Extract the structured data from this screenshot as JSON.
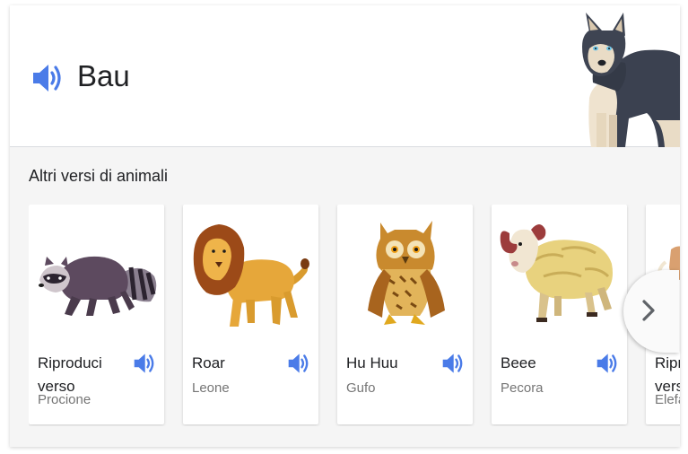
{
  "main": {
    "sound": "Bau",
    "speaker_icon": "speaker-icon",
    "image": "husky-dog"
  },
  "section": {
    "title": "Altri versi di animali"
  },
  "cards": [
    {
      "sound": "Riproduci verso",
      "animal": "Procione",
      "image": "raccoon"
    },
    {
      "sound": "Roar",
      "animal": "Leone",
      "image": "lion"
    },
    {
      "sound": "Hu Huu",
      "animal": "Gufo",
      "image": "owl"
    },
    {
      "sound": "Beee",
      "animal": "Pecora",
      "image": "sheep"
    },
    {
      "sound": "Riproduci verso",
      "animal": "Elefante",
      "image": "elephant"
    }
  ],
  "next_button": {
    "icon": "chevron-right-icon"
  },
  "colors": {
    "accent": "#4a7be8",
    "label": "#757575"
  }
}
